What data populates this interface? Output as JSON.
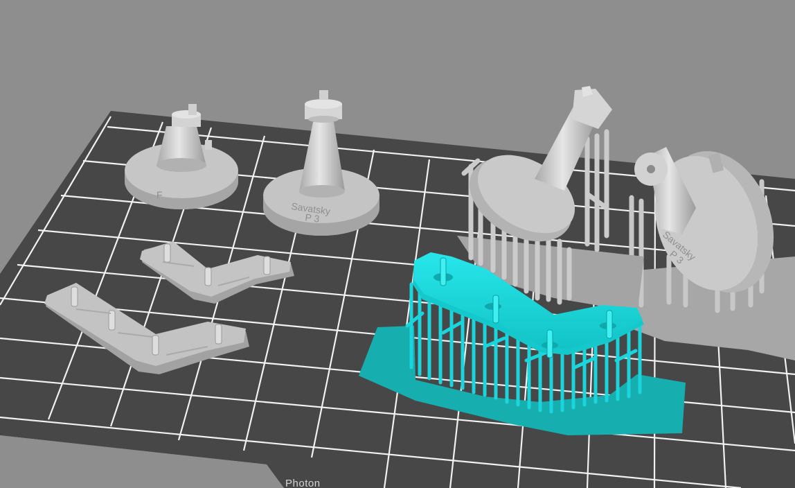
{
  "viewport": {
    "background": "#8e8e8e",
    "plate_color": "#474747",
    "grid_color": "#f2f2f2",
    "model_color": "#c0c0c0",
    "selected_color": "#1ad6dc",
    "raft_color": "#17aeb0"
  },
  "plate": {
    "label": "Photon"
  },
  "models": [
    {
      "name": "rook-engraving",
      "line1": "Savatsky",
      "line2": "P 3"
    },
    {
      "name": "tilted-rook-engraving",
      "line1": "Savatsky",
      "line2": "P 3"
    }
  ]
}
